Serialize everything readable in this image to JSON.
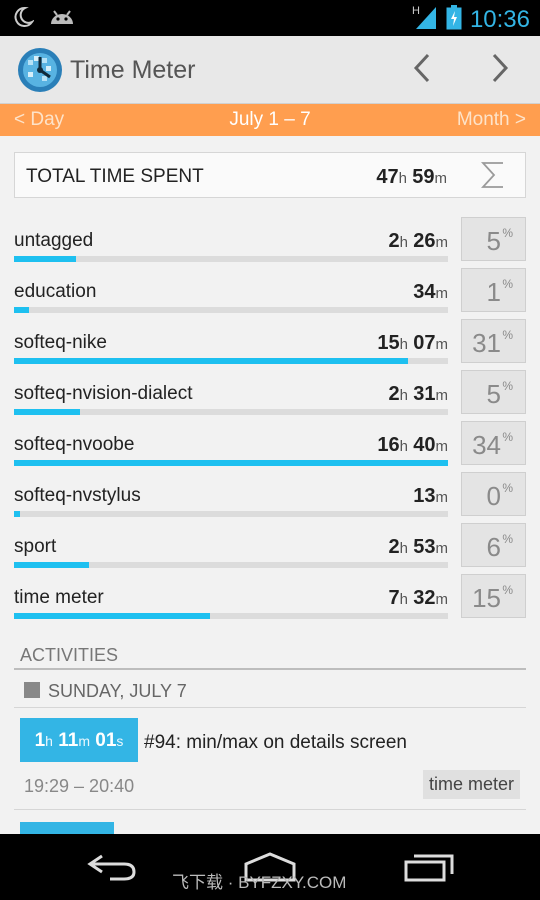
{
  "status_bar": {
    "time": "10:36",
    "icons": [
      "moon-icon",
      "android-icon",
      "signal-icon",
      "battery-icon"
    ]
  },
  "action_bar": {
    "title": "Time Meter",
    "icons": [
      "app-icon",
      "chevron-left-icon",
      "chevron-right-icon"
    ]
  },
  "period": {
    "prev": "< Day",
    "current": "July 1 – 7",
    "next": "Month >"
  },
  "total": {
    "label": "TOTAL TIME SPENT",
    "hours": "47",
    "h_unit": "h",
    "minutes": "59",
    "m_unit": "m",
    "icon": "sigma-icon"
  },
  "tags": [
    {
      "name": "untagged",
      "hours": "2",
      "minutes": "26",
      "percent": "5",
      "fraction": 0.144
    },
    {
      "name": "education",
      "minutes": "34",
      "percent": "1",
      "fraction": 0.035
    },
    {
      "name": "softeq-nike",
      "hours": "15",
      "minutes": "07",
      "percent": "31",
      "fraction": 0.907
    },
    {
      "name": "softeq-nvision-dialect",
      "hours": "2",
      "minutes": "31",
      "percent": "5",
      "fraction": 0.151
    },
    {
      "name": "softeq-nvoobe",
      "hours": "16",
      "minutes": "40",
      "percent": "34",
      "fraction": 1.0
    },
    {
      "name": "softeq-nvstylus",
      "minutes": "13",
      "percent": "0",
      "fraction": 0.013
    },
    {
      "name": "sport",
      "hours": "2",
      "minutes": "53",
      "percent": "6",
      "fraction": 0.173
    },
    {
      "name": "time meter",
      "hours": "7",
      "minutes": "32",
      "percent": "15",
      "fraction": 0.452
    }
  ],
  "units": {
    "h": "h",
    "m": "m",
    "s": "s",
    "pct": "%"
  },
  "activities": {
    "header": "ACTIVITIES",
    "day": "SUNDAY, JULY 7",
    "items": [
      {
        "hours": "1",
        "minutes": "11",
        "seconds": "01",
        "title": "#94: min/max on details screen",
        "range": "19:29 – 20:40",
        "tag": "time meter"
      }
    ]
  },
  "nav_bar": {
    "icons": [
      "back-icon",
      "home-icon",
      "recents-icon"
    ],
    "watermark": "飞下载 · BYFZXY.COM"
  },
  "colors": {
    "accent": "#33b5e5",
    "progress": "#1ec0f0",
    "period_bar": "#ff9e4f"
  }
}
